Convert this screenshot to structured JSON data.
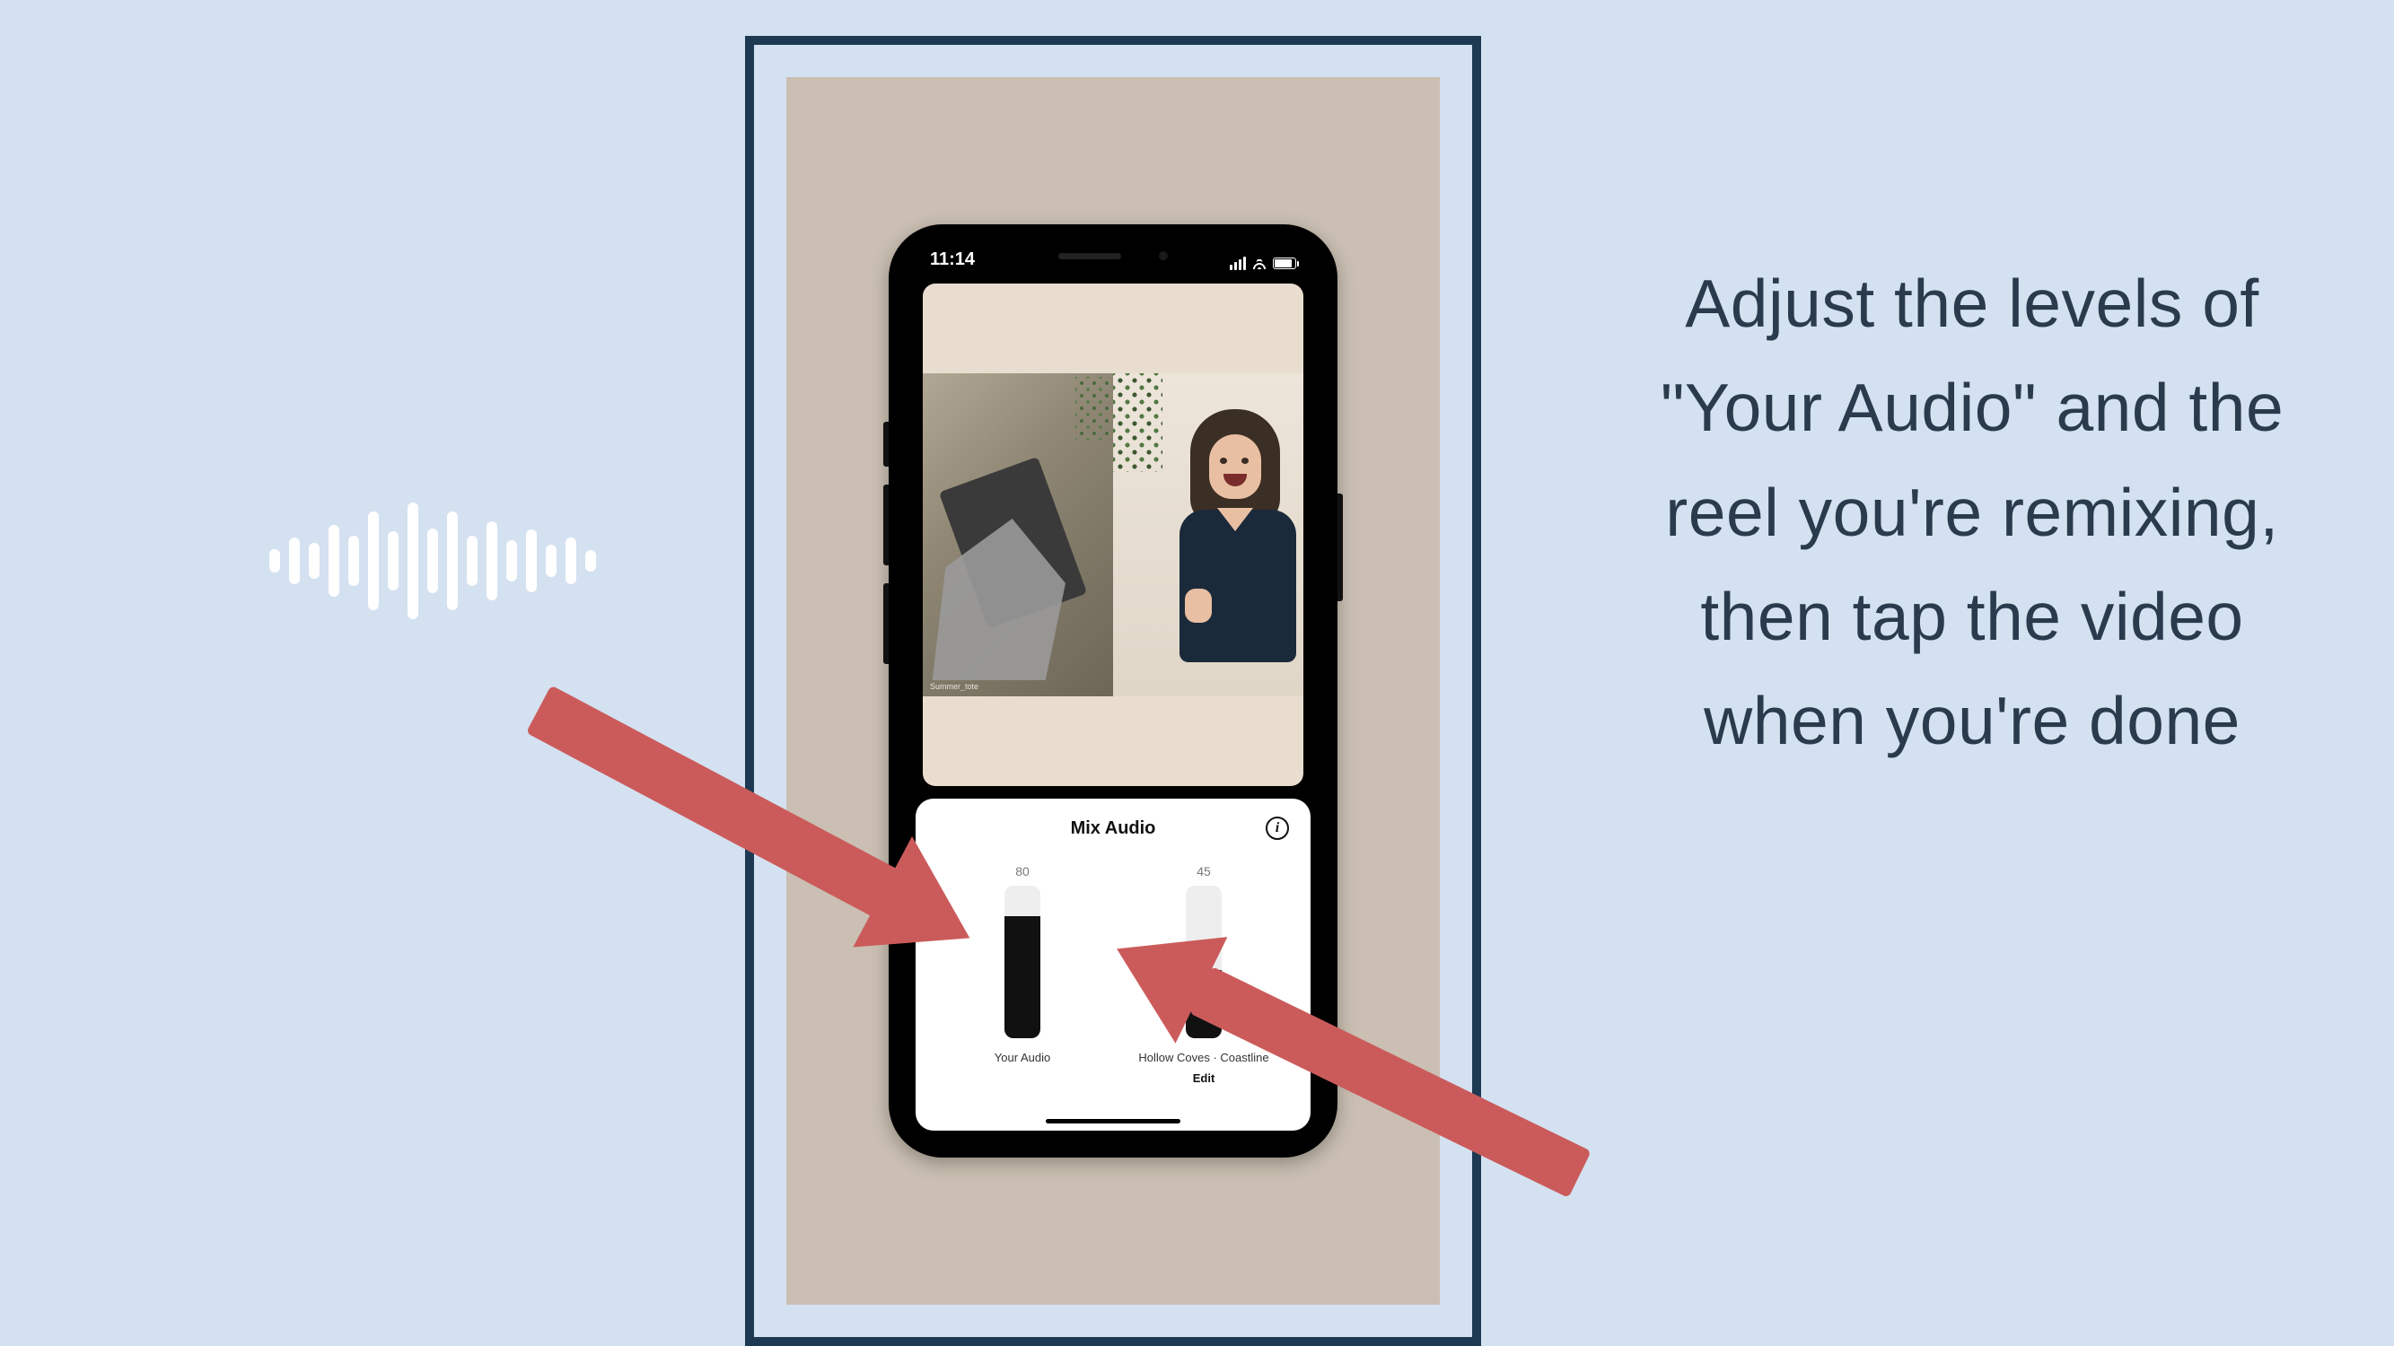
{
  "instruction_text": "Adjust the levels of \"Your Audio\" and the reel you're remixing, then tap the video when you're done",
  "phone": {
    "status_time": "11:14",
    "reel_left_caption": "Summer_tote"
  },
  "mix_panel": {
    "title": "Mix Audio",
    "info_glyph": "i",
    "sliders": [
      {
        "value": "80",
        "fill_pct": 80,
        "label": "Your Audio",
        "edit": ""
      },
      {
        "value": "45",
        "fill_pct": 45,
        "label": "Hollow Coves · Coastline",
        "edit": "Edit"
      }
    ]
  },
  "soundwave_heights": [
    26,
    52,
    40,
    80,
    56,
    110,
    66,
    130,
    72,
    110,
    56,
    88,
    46,
    70,
    36,
    52,
    24
  ]
}
